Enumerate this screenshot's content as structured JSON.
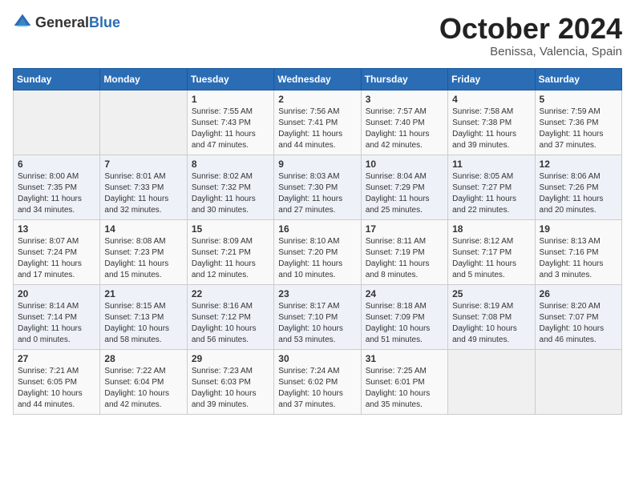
{
  "header": {
    "logo_general": "General",
    "logo_blue": "Blue",
    "month_title": "October 2024",
    "subtitle": "Benissa, Valencia, Spain"
  },
  "days_of_week": [
    "Sunday",
    "Monday",
    "Tuesday",
    "Wednesday",
    "Thursday",
    "Friday",
    "Saturday"
  ],
  "weeks": [
    [
      {
        "day": "",
        "sunrise": "",
        "sunset": "",
        "daylight": ""
      },
      {
        "day": "",
        "sunrise": "",
        "sunset": "",
        "daylight": ""
      },
      {
        "day": "1",
        "sunrise": "Sunrise: 7:55 AM",
        "sunset": "Sunset: 7:43 PM",
        "daylight": "Daylight: 11 hours and 47 minutes."
      },
      {
        "day": "2",
        "sunrise": "Sunrise: 7:56 AM",
        "sunset": "Sunset: 7:41 PM",
        "daylight": "Daylight: 11 hours and 44 minutes."
      },
      {
        "day": "3",
        "sunrise": "Sunrise: 7:57 AM",
        "sunset": "Sunset: 7:40 PM",
        "daylight": "Daylight: 11 hours and 42 minutes."
      },
      {
        "day": "4",
        "sunrise": "Sunrise: 7:58 AM",
        "sunset": "Sunset: 7:38 PM",
        "daylight": "Daylight: 11 hours and 39 minutes."
      },
      {
        "day": "5",
        "sunrise": "Sunrise: 7:59 AM",
        "sunset": "Sunset: 7:36 PM",
        "daylight": "Daylight: 11 hours and 37 minutes."
      }
    ],
    [
      {
        "day": "6",
        "sunrise": "Sunrise: 8:00 AM",
        "sunset": "Sunset: 7:35 PM",
        "daylight": "Daylight: 11 hours and 34 minutes."
      },
      {
        "day": "7",
        "sunrise": "Sunrise: 8:01 AM",
        "sunset": "Sunset: 7:33 PM",
        "daylight": "Daylight: 11 hours and 32 minutes."
      },
      {
        "day": "8",
        "sunrise": "Sunrise: 8:02 AM",
        "sunset": "Sunset: 7:32 PM",
        "daylight": "Daylight: 11 hours and 30 minutes."
      },
      {
        "day": "9",
        "sunrise": "Sunrise: 8:03 AM",
        "sunset": "Sunset: 7:30 PM",
        "daylight": "Daylight: 11 hours and 27 minutes."
      },
      {
        "day": "10",
        "sunrise": "Sunrise: 8:04 AM",
        "sunset": "Sunset: 7:29 PM",
        "daylight": "Daylight: 11 hours and 25 minutes."
      },
      {
        "day": "11",
        "sunrise": "Sunrise: 8:05 AM",
        "sunset": "Sunset: 7:27 PM",
        "daylight": "Daylight: 11 hours and 22 minutes."
      },
      {
        "day": "12",
        "sunrise": "Sunrise: 8:06 AM",
        "sunset": "Sunset: 7:26 PM",
        "daylight": "Daylight: 11 hours and 20 minutes."
      }
    ],
    [
      {
        "day": "13",
        "sunrise": "Sunrise: 8:07 AM",
        "sunset": "Sunset: 7:24 PM",
        "daylight": "Daylight: 11 hours and 17 minutes."
      },
      {
        "day": "14",
        "sunrise": "Sunrise: 8:08 AM",
        "sunset": "Sunset: 7:23 PM",
        "daylight": "Daylight: 11 hours and 15 minutes."
      },
      {
        "day": "15",
        "sunrise": "Sunrise: 8:09 AM",
        "sunset": "Sunset: 7:21 PM",
        "daylight": "Daylight: 11 hours and 12 minutes."
      },
      {
        "day": "16",
        "sunrise": "Sunrise: 8:10 AM",
        "sunset": "Sunset: 7:20 PM",
        "daylight": "Daylight: 11 hours and 10 minutes."
      },
      {
        "day": "17",
        "sunrise": "Sunrise: 8:11 AM",
        "sunset": "Sunset: 7:19 PM",
        "daylight": "Daylight: 11 hours and 8 minutes."
      },
      {
        "day": "18",
        "sunrise": "Sunrise: 8:12 AM",
        "sunset": "Sunset: 7:17 PM",
        "daylight": "Daylight: 11 hours and 5 minutes."
      },
      {
        "day": "19",
        "sunrise": "Sunrise: 8:13 AM",
        "sunset": "Sunset: 7:16 PM",
        "daylight": "Daylight: 11 hours and 3 minutes."
      }
    ],
    [
      {
        "day": "20",
        "sunrise": "Sunrise: 8:14 AM",
        "sunset": "Sunset: 7:14 PM",
        "daylight": "Daylight: 11 hours and 0 minutes."
      },
      {
        "day": "21",
        "sunrise": "Sunrise: 8:15 AM",
        "sunset": "Sunset: 7:13 PM",
        "daylight": "Daylight: 10 hours and 58 minutes."
      },
      {
        "day": "22",
        "sunrise": "Sunrise: 8:16 AM",
        "sunset": "Sunset: 7:12 PM",
        "daylight": "Daylight: 10 hours and 56 minutes."
      },
      {
        "day": "23",
        "sunrise": "Sunrise: 8:17 AM",
        "sunset": "Sunset: 7:10 PM",
        "daylight": "Daylight: 10 hours and 53 minutes."
      },
      {
        "day": "24",
        "sunrise": "Sunrise: 8:18 AM",
        "sunset": "Sunset: 7:09 PM",
        "daylight": "Daylight: 10 hours and 51 minutes."
      },
      {
        "day": "25",
        "sunrise": "Sunrise: 8:19 AM",
        "sunset": "Sunset: 7:08 PM",
        "daylight": "Daylight: 10 hours and 49 minutes."
      },
      {
        "day": "26",
        "sunrise": "Sunrise: 8:20 AM",
        "sunset": "Sunset: 7:07 PM",
        "daylight": "Daylight: 10 hours and 46 minutes."
      }
    ],
    [
      {
        "day": "27",
        "sunrise": "Sunrise: 7:21 AM",
        "sunset": "Sunset: 6:05 PM",
        "daylight": "Daylight: 10 hours and 44 minutes."
      },
      {
        "day": "28",
        "sunrise": "Sunrise: 7:22 AM",
        "sunset": "Sunset: 6:04 PM",
        "daylight": "Daylight: 10 hours and 42 minutes."
      },
      {
        "day": "29",
        "sunrise": "Sunrise: 7:23 AM",
        "sunset": "Sunset: 6:03 PM",
        "daylight": "Daylight: 10 hours and 39 minutes."
      },
      {
        "day": "30",
        "sunrise": "Sunrise: 7:24 AM",
        "sunset": "Sunset: 6:02 PM",
        "daylight": "Daylight: 10 hours and 37 minutes."
      },
      {
        "day": "31",
        "sunrise": "Sunrise: 7:25 AM",
        "sunset": "Sunset: 6:01 PM",
        "daylight": "Daylight: 10 hours and 35 minutes."
      },
      {
        "day": "",
        "sunrise": "",
        "sunset": "",
        "daylight": ""
      },
      {
        "day": "",
        "sunrise": "",
        "sunset": "",
        "daylight": ""
      }
    ]
  ]
}
